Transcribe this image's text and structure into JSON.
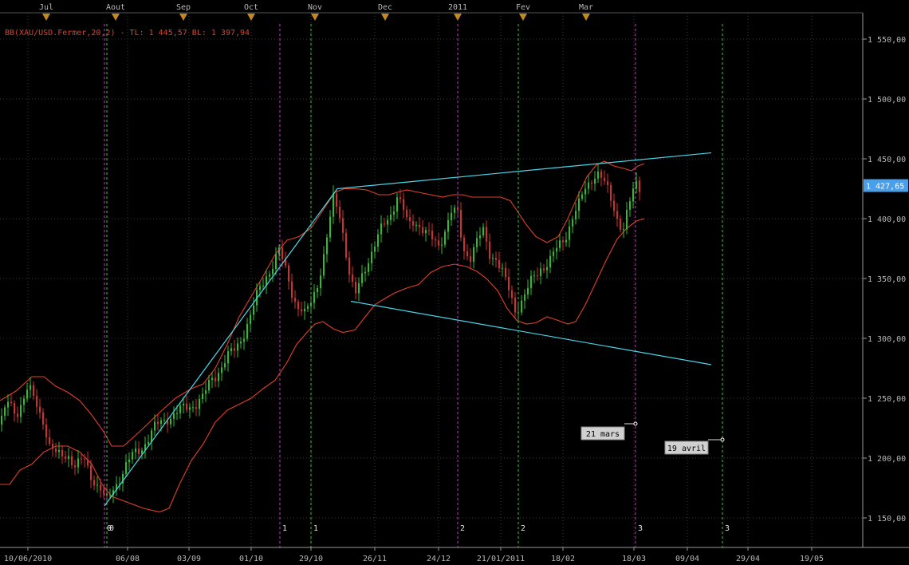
{
  "indicator_label": "BB(XAU/USD.Fermer,20,2) - TL: 1 445,57  BL: 1 397,94",
  "colors": {
    "background": "#000000",
    "grid": "#3a3a3a",
    "bull_candle": "#2bbf2b",
    "bear_candle": "#d03030",
    "bollinger": "#e0402a",
    "trendline": "#49d6e8",
    "price_tag": "#4a9fea",
    "cycle_purple": "#c040c0",
    "cycle_green": "#40c040",
    "month_marker": "#c08a20"
  },
  "months": [
    "Jul",
    "Aout",
    "Sep",
    "Oct",
    "Nov",
    "Dec",
    "2011",
    "Fev",
    "Mar"
  ],
  "annotations": [
    {
      "id": "march",
      "text": "21 mars"
    },
    {
      "id": "april",
      "text": "19 avril"
    }
  ],
  "chart_data": {
    "type": "candlestick",
    "instrument": "XAU/USD",
    "x_ticks": [
      "10/06/2010",
      "06/08",
      "03/09",
      "01/10",
      "29/10",
      "26/11",
      "24/12",
      "21/01/2011",
      "18/02",
      "18/03",
      "09/04",
      "29/04",
      "19/05"
    ],
    "y_ticks": [
      "1 150,00",
      "1 200,00",
      "1 250,00",
      "1 300,00",
      "1 350,00",
      "1 400,00",
      "1 450,00",
      "1 500,00",
      "1 550,00"
    ],
    "ylim": [
      1135,
      1580
    ],
    "current_price": "1 427,65",
    "bollinger": {
      "period": 20,
      "deviations": 2,
      "upper_last": 1445.57,
      "lower_last": 1397.94
    },
    "cycle_lines": [
      {
        "color": "purple",
        "label": "0"
      },
      {
        "color": "green",
        "label": "0"
      },
      {
        "color": "purple",
        "label": "1"
      },
      {
        "color": "green",
        "label": "1"
      },
      {
        "color": "purple",
        "label": "2"
      },
      {
        "color": "green",
        "label": "2"
      },
      {
        "color": "purple",
        "label": "3"
      },
      {
        "color": "green",
        "label": "3"
      }
    ],
    "price_path": [
      [
        0,
        1228
      ],
      [
        10,
        1245
      ],
      [
        20,
        1238
      ],
      [
        35,
        1258
      ],
      [
        45,
        1245
      ],
      [
        55,
        1232
      ],
      [
        62,
        1210
      ],
      [
        72,
        1200
      ],
      [
        85,
        1205
      ],
      [
        95,
        1192
      ],
      [
        105,
        1198
      ],
      [
        113,
        1188
      ],
      [
        120,
        1180
      ],
      [
        128,
        1172
      ],
      [
        133,
        1160
      ],
      [
        140,
        1172
      ],
      [
        150,
        1185
      ],
      [
        165,
        1200
      ],
      [
        180,
        1212
      ],
      [
        195,
        1225
      ],
      [
        210,
        1235
      ],
      [
        225,
        1238
      ],
      [
        240,
        1245
      ],
      [
        255,
        1250
      ],
      [
        265,
        1265
      ],
      [
        280,
        1280
      ],
      [
        295,
        1290
      ],
      [
        305,
        1305
      ],
      [
        315,
        1320
      ],
      [
        325,
        1340
      ],
      [
        335,
        1355
      ],
      [
        345,
        1365
      ],
      [
        350,
        1372
      ],
      [
        355,
        1362
      ],
      [
        362,
        1350
      ],
      [
        368,
        1335
      ],
      [
        375,
        1325
      ],
      [
        382,
        1318
      ],
      [
        390,
        1330
      ],
      [
        397,
        1345
      ],
      [
        405,
        1365
      ],
      [
        412,
        1390
      ],
      [
        418,
        1415
      ],
      [
        425,
        1408
      ],
      [
        430,
        1390
      ],
      [
        435,
        1368
      ],
      [
        440,
        1345
      ],
      [
        446,
        1335
      ],
      [
        452,
        1348
      ],
      [
        460,
        1365
      ],
      [
        470,
        1378
      ],
      [
        480,
        1392
      ],
      [
        490,
        1405
      ],
      [
        498,
        1420
      ],
      [
        505,
        1408
      ],
      [
        512,
        1392
      ],
      [
        520,
        1400
      ],
      [
        530,
        1392
      ],
      [
        540,
        1382
      ],
      [
        550,
        1378
      ],
      [
        558,
        1392
      ],
      [
        566,
        1405
      ],
      [
        575,
        1402
      ],
      [
        580,
        1375
      ],
      [
        590,
        1370
      ],
      [
        598,
        1380
      ],
      [
        606,
        1388
      ],
      [
        614,
        1372
      ],
      [
        622,
        1368
      ],
      [
        632,
        1350
      ],
      [
        640,
        1336
      ],
      [
        646,
        1325
      ],
      [
        652,
        1330
      ],
      [
        660,
        1338
      ],
      [
        668,
        1348
      ],
      [
        678,
        1360
      ],
      [
        690,
        1365
      ],
      [
        700,
        1375
      ],
      [
        710,
        1388
      ],
      [
        718,
        1402
      ],
      [
        726,
        1410
      ],
      [
        734,
        1425
      ],
      [
        742,
        1435
      ],
      [
        748,
        1440
      ],
      [
        755,
        1432
      ],
      [
        762,
        1422
      ],
      [
        770,
        1410
      ],
      [
        776,
        1398
      ],
      [
        782,
        1392
      ],
      [
        790,
        1412
      ],
      [
        797,
        1430
      ],
      [
        803,
        1427
      ]
    ],
    "upper_band": [
      [
        0,
        1248
      ],
      [
        20,
        1256
      ],
      [
        40,
        1268
      ],
      [
        55,
        1268
      ],
      [
        70,
        1260
      ],
      [
        85,
        1255
      ],
      [
        100,
        1248
      ],
      [
        115,
        1236
      ],
      [
        130,
        1222
      ],
      [
        140,
        1210
      ],
      [
        155,
        1210
      ],
      [
        175,
        1222
      ],
      [
        200,
        1238
      ],
      [
        220,
        1250
      ],
      [
        240,
        1258
      ],
      [
        255,
        1262
      ],
      [
        270,
        1275
      ],
      [
        285,
        1295
      ],
      [
        300,
        1318
      ],
      [
        315,
        1335
      ],
      [
        330,
        1352
      ],
      [
        345,
        1370
      ],
      [
        360,
        1382
      ],
      [
        375,
        1385
      ],
      [
        390,
        1392
      ],
      [
        400,
        1402
      ],
      [
        410,
        1412
      ],
      [
        420,
        1422
      ],
      [
        432,
        1425
      ],
      [
        445,
        1425
      ],
      [
        460,
        1424
      ],
      [
        475,
        1420
      ],
      [
        488,
        1420
      ],
      [
        498,
        1422
      ],
      [
        510,
        1424
      ],
      [
        525,
        1422
      ],
      [
        540,
        1420
      ],
      [
        555,
        1418
      ],
      [
        568,
        1420
      ],
      [
        580,
        1420
      ],
      [
        592,
        1418
      ],
      [
        610,
        1418
      ],
      [
        628,
        1418
      ],
      [
        640,
        1415
      ],
      [
        650,
        1405
      ],
      [
        660,
        1395
      ],
      [
        672,
        1385
      ],
      [
        686,
        1380
      ],
      [
        700,
        1385
      ],
      [
        712,
        1400
      ],
      [
        724,
        1418
      ],
      [
        736,
        1435
      ],
      [
        748,
        1445
      ],
      [
        758,
        1448
      ],
      [
        770,
        1444
      ],
      [
        782,
        1442
      ],
      [
        792,
        1440
      ],
      [
        800,
        1444
      ],
      [
        808,
        1446
      ]
    ],
    "lower_band": [
      [
        0,
        1178
      ],
      [
        12,
        1178
      ],
      [
        25,
        1190
      ],
      [
        40,
        1195
      ],
      [
        55,
        1205
      ],
      [
        70,
        1210
      ],
      [
        85,
        1210
      ],
      [
        100,
        1205
      ],
      [
        115,
        1195
      ],
      [
        128,
        1178
      ],
      [
        140,
        1168
      ],
      [
        160,
        1163
      ],
      [
        180,
        1158
      ],
      [
        200,
        1155
      ],
      [
        212,
        1158
      ],
      [
        225,
        1178
      ],
      [
        240,
        1198
      ],
      [
        255,
        1212
      ],
      [
        270,
        1230
      ],
      [
        285,
        1240
      ],
      [
        300,
        1245
      ],
      [
        315,
        1250
      ],
      [
        330,
        1258
      ],
      [
        345,
        1265
      ],
      [
        360,
        1280
      ],
      [
        372,
        1295
      ],
      [
        385,
        1305
      ],
      [
        395,
        1312
      ],
      [
        405,
        1314
      ],
      [
        418,
        1308
      ],
      [
        430,
        1305
      ],
      [
        445,
        1307
      ],
      [
        458,
        1318
      ],
      [
        470,
        1328
      ],
      [
        482,
        1333
      ],
      [
        495,
        1338
      ],
      [
        510,
        1342
      ],
      [
        525,
        1345
      ],
      [
        540,
        1355
      ],
      [
        555,
        1360
      ],
      [
        570,
        1362
      ],
      [
        585,
        1360
      ],
      [
        598,
        1356
      ],
      [
        610,
        1350
      ],
      [
        624,
        1340
      ],
      [
        636,
        1325
      ],
      [
        648,
        1315
      ],
      [
        660,
        1312
      ],
      [
        672,
        1313
      ],
      [
        686,
        1318
      ],
      [
        700,
        1315
      ],
      [
        712,
        1312
      ],
      [
        722,
        1314
      ],
      [
        734,
        1328
      ],
      [
        746,
        1345
      ],
      [
        760,
        1365
      ],
      [
        774,
        1383
      ],
      [
        786,
        1392
      ],
      [
        798,
        1398
      ],
      [
        808,
        1400
      ]
    ]
  }
}
